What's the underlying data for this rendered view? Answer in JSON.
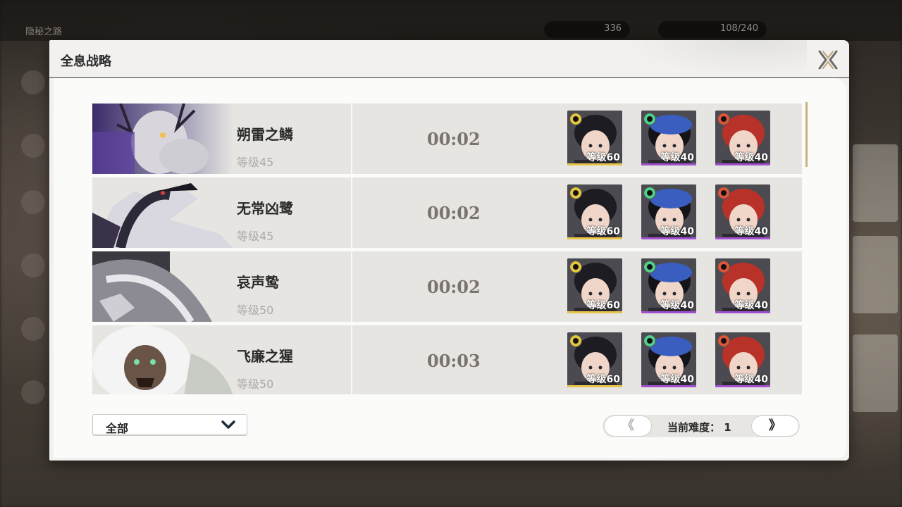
{
  "background": {
    "back_title": "隐秘之路",
    "resource_1": "336",
    "resource_2": "108/240"
  },
  "modal": {
    "title": "全息战略"
  },
  "bosses": [
    {
      "name": "朔雷之鳞",
      "level": "等级45",
      "time": "00:02",
      "team": [
        {
          "level": "等级60",
          "element": "spectro",
          "bar": "#e8c447"
        },
        {
          "level": "等级40",
          "element": "aero",
          "bar": "#a24fd0"
        },
        {
          "level": "等级40",
          "element": "fusion",
          "bar": "#a24fd0"
        }
      ]
    },
    {
      "name": "无常凶鹭",
      "level": "等级45",
      "time": "00:02",
      "team": [
        {
          "level": "等级60",
          "element": "spectro",
          "bar": "#e8c447"
        },
        {
          "level": "等级40",
          "element": "aero",
          "bar": "#a24fd0"
        },
        {
          "level": "等级40",
          "element": "fusion",
          "bar": "#a24fd0"
        }
      ]
    },
    {
      "name": "哀声鸷",
      "level": "等级50",
      "time": "00:02",
      "team": [
        {
          "level": "等级60",
          "element": "spectro",
          "bar": "#e8c447"
        },
        {
          "level": "等级40",
          "element": "aero",
          "bar": "#a24fd0"
        },
        {
          "level": "等级40",
          "element": "fusion",
          "bar": "#a24fd0"
        }
      ]
    },
    {
      "name": "飞廉之猩",
      "level": "等级50",
      "time": "00:03",
      "team": [
        {
          "level": "等级60",
          "element": "spectro",
          "bar": "#e8c447"
        },
        {
          "level": "等级40",
          "element": "aero",
          "bar": "#a24fd0"
        },
        {
          "level": "等级40",
          "element": "fusion",
          "bar": "#a24fd0"
        }
      ]
    }
  ],
  "footer": {
    "filter_value": "全部",
    "prev_label": "《",
    "next_label": "》",
    "difficulty_label": "当前难度：",
    "difficulty_value": "1"
  },
  "colors": {
    "accent_gold": "#c9b27a",
    "five_star": "#e8c447",
    "four_star": "#a24fd0",
    "spectro": "#e3c540",
    "aero": "#4fd08a",
    "fusion": "#e0553a"
  }
}
